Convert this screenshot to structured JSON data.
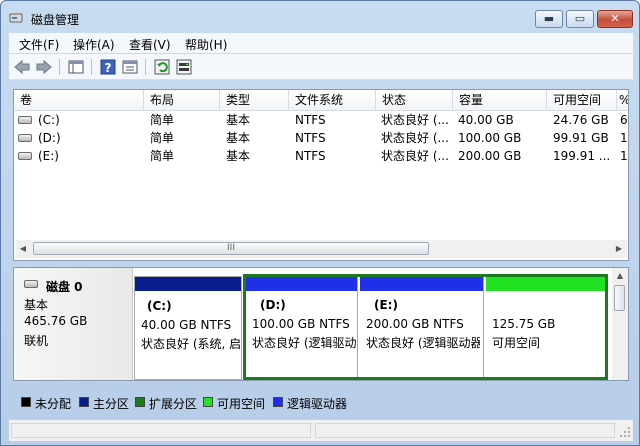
{
  "window": {
    "title": "磁盘管理",
    "minimize_label": "▬",
    "maximize_label": "▭",
    "close_label": "✕"
  },
  "menu": {
    "items": [
      "文件(F)",
      "操作(A)",
      "查看(V)",
      "帮助(H)"
    ]
  },
  "volume_list": {
    "columns": [
      "卷",
      "布局",
      "类型",
      "文件系统",
      "状态",
      "容量",
      "可用空间",
      "%"
    ],
    "rows": [
      {
        "volume": "(C:)",
        "layout": "简单",
        "type": "基本",
        "fs": "NTFS",
        "status": "状态良好 (...",
        "capacity": "40.00 GB",
        "free": "24.76 GB",
        "pct": "6"
      },
      {
        "volume": "(D:)",
        "layout": "简单",
        "type": "基本",
        "fs": "NTFS",
        "status": "状态良好 (...",
        "capacity": "100.00 GB",
        "free": "99.91 GB",
        "pct": "1"
      },
      {
        "volume": "(E:)",
        "layout": "简单",
        "type": "基本",
        "fs": "NTFS",
        "status": "状态良好 (...",
        "capacity": "200.00 GB",
        "free": "199.91 ...",
        "pct": "1"
      }
    ],
    "scroll_grip": "III"
  },
  "disk": {
    "name": "磁盘 0",
    "kind": "基本",
    "size": "465.76 GB",
    "status": "联机",
    "partitions": [
      {
        "label": "(C:)",
        "size": "40.00 GB NTFS",
        "status": "状态良好 (系统, 启",
        "color": "#0a1f8f"
      },
      {
        "label": "(D:)",
        "size": "100.00 GB NTFS",
        "status": "状态良好 (逻辑驱动",
        "color": "#2030e6"
      },
      {
        "label": "(E:)",
        "size": "200.00 GB NTFS",
        "status": "状态良好 (逻辑驱动器",
        "color": "#2030e6"
      },
      {
        "label": "",
        "size": "125.75 GB",
        "status": "可用空间",
        "color": "#22e022"
      }
    ],
    "extended_border_color": "#1e7a1e"
  },
  "legend": [
    {
      "label": "未分配",
      "color": "#000000"
    },
    {
      "label": "主分区",
      "color": "#0a1f8f"
    },
    {
      "label": "扩展分区",
      "color": "#1e7a1e"
    },
    {
      "label": "可用空间",
      "color": "#22e022"
    },
    {
      "label": "逻辑驱动器",
      "color": "#2030e6"
    }
  ]
}
